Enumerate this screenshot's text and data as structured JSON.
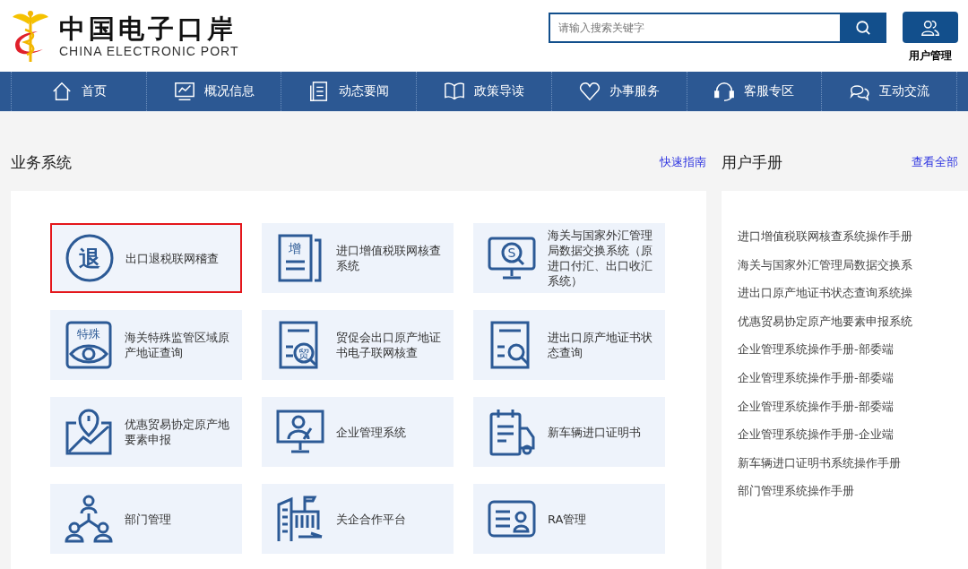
{
  "header": {
    "logo_title": "中国电子口岸",
    "logo_subtitle": "CHINA ELECTRONIC PORT",
    "search": {
      "placeholder": "请输入搜索关键字"
    },
    "user_button": {
      "label": "用户管理"
    }
  },
  "nav": [
    {
      "label": "首页",
      "kind": "home"
    },
    {
      "label": "概况信息",
      "kind": "chart"
    },
    {
      "label": "动态要闻",
      "kind": "news"
    },
    {
      "label": "政策导读",
      "kind": "book"
    },
    {
      "label": "办事服务",
      "kind": "heart"
    },
    {
      "label": "客服专区",
      "kind": "headset"
    },
    {
      "label": "互动交流",
      "kind": "chat"
    }
  ],
  "systems": {
    "title": "业务系统",
    "link": "快速指南",
    "tiles": [
      {
        "label": "出口退税联网稽查",
        "kind": "circle-char",
        "icon_text": "退",
        "selected": true
      },
      {
        "label": "进口增值税联网核查系统",
        "kind": "doc-char",
        "icon_text": "增",
        "selected": false
      },
      {
        "label": "海关与国家外汇管理局数据交换系统（原进口付汇、出口收汇系统）",
        "kind": "monitor-search",
        "icon_text": "S",
        "selected": false
      },
      {
        "label": "海关特殊监管区域原产地证查询",
        "kind": "eye-card",
        "icon_text": "特殊",
        "selected": false
      },
      {
        "label": "贸促会出口原产地证书电子联网核查",
        "kind": "doc-search-char",
        "icon_text": "贸",
        "selected": false
      },
      {
        "label": "进出口原产地证书状态查询",
        "kind": "doc-search",
        "selected": false
      },
      {
        "label": "优惠贸易协定原产地要素申报",
        "kind": "map-pin",
        "selected": false
      },
      {
        "label": "企业管理系统",
        "kind": "monitor-person",
        "selected": false
      },
      {
        "label": "新车辆进口证明书",
        "kind": "truck-doc",
        "selected": false
      },
      {
        "label": "部门管理",
        "kind": "org",
        "selected": false
      },
      {
        "label": "关企合作平台",
        "kind": "buildings",
        "selected": false
      },
      {
        "label": "RA管理",
        "kind": "id-card",
        "selected": false
      }
    ]
  },
  "manuals": {
    "title": "用户手册",
    "link": "查看全部",
    "items": [
      "进口增值税联网核查系统操作手册",
      "海关与国家外汇管理局数据交换系",
      "进出口原产地证书状态查询系统操",
      "优惠贸易协定原产地要素申报系统",
      "企业管理系统操作手册-部委端",
      "企业管理系统操作手册-部委端",
      "企业管理系统操作手册-部委端",
      "企业管理系统操作手册-企业端",
      "新车辆进口证明书系统操作手册",
      "部门管理系统操作手册"
    ]
  }
}
